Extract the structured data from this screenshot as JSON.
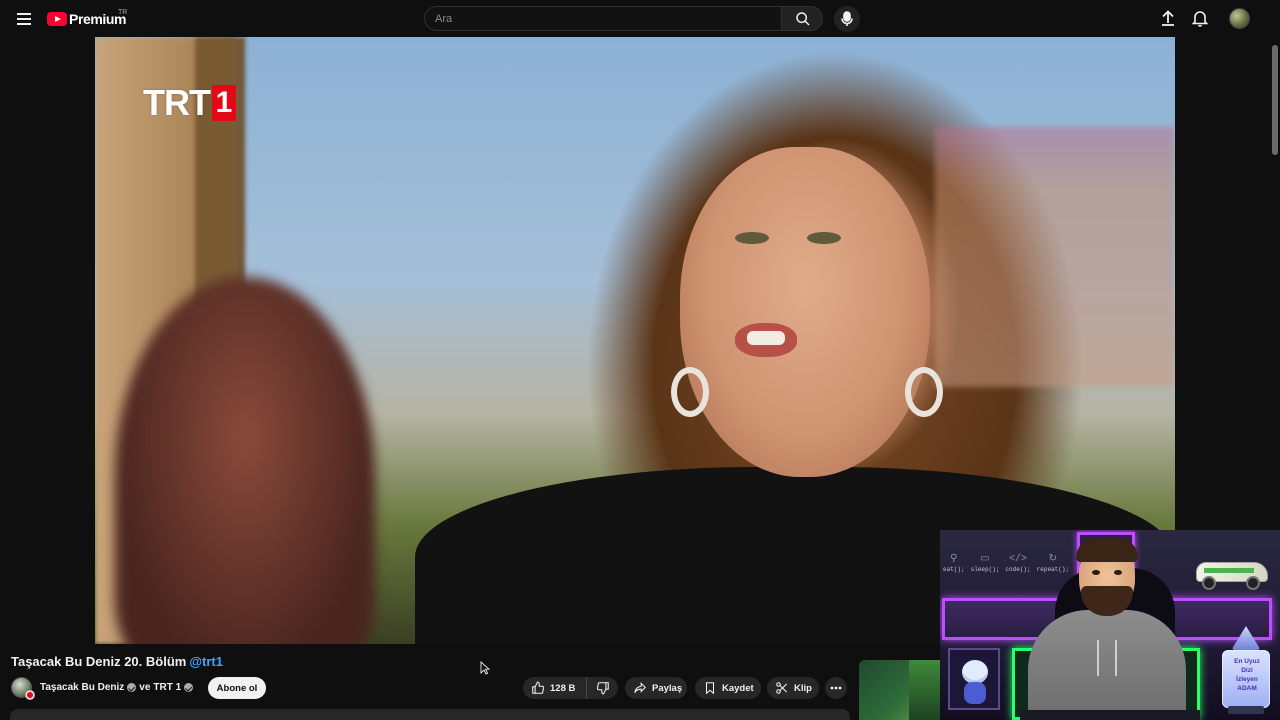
{
  "header": {
    "logo_text": "Premium",
    "region": "TR",
    "search_placeholder": "Ara",
    "icons": [
      "menu-icon",
      "youtube-logo-icon",
      "search-icon",
      "microphone-icon",
      "upload-icon",
      "bell-icon",
      "account-avatar"
    ]
  },
  "player": {
    "channel_logo": "TRT",
    "channel_logo_num": "1"
  },
  "video": {
    "title": "Taşacak Bu Deniz 20. Bölüm",
    "title_tag": "@trt1",
    "channel_primary": "Taşacak Bu Deniz",
    "channel_joiner": "ve",
    "channel_secondary": "TRT 1",
    "subscribe_label": "Abone ol",
    "like_count": "128 B",
    "share_label": "Paylaş",
    "save_label": "Kaydet",
    "clip_label": "Klip"
  },
  "overlay": {
    "wall_tags": [
      "eat();",
      "sleep();",
      "code();",
      "repeat();"
    ],
    "award_lines": [
      "En Uyuz",
      "Dizi",
      "İzleyen",
      "ADAM"
    ]
  },
  "colors": {
    "background": "#0f0f0f",
    "brand_red": "#ff0033",
    "link_blue": "#3ea6ff",
    "pill_bg": "#272727",
    "trt_red": "#e30a17"
  }
}
